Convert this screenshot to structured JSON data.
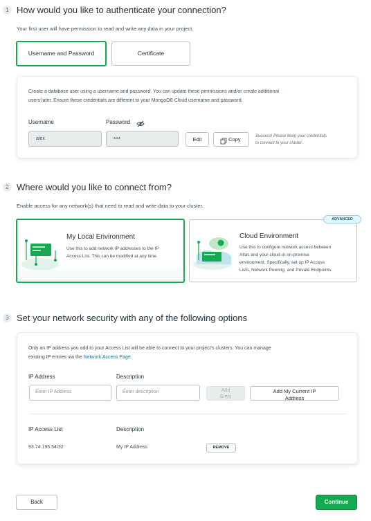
{
  "step1": {
    "number": "1",
    "title": "How would you like to authenticate your connection?",
    "description": "Your first user will have permission to read and write any data in your project.",
    "tabs": [
      {
        "label": "Username and Password"
      },
      {
        "label": "Certificate"
      }
    ],
    "panel": {
      "description_line1": "Create a database user using a username and password. You can update these permissions and/or create additional",
      "description_line2": "users later. Ensure these credentials are different to your MongoDB Cloud username and password.",
      "username_label": "Username",
      "password_label": "Password",
      "username_value": "alex",
      "password_value": "••••",
      "edit_label": "Edit",
      "copy_label": "Copy",
      "success_line1": "Success! Please keep your credentials",
      "success_line2": "to connect to your cluster."
    }
  },
  "step2": {
    "number": "2",
    "title": "Where would you like to connect from?",
    "description": "Enable access for any network(s) that need to read and write data to your cluster.",
    "badge": "ADVANCED",
    "local": {
      "title": "My Local Environment",
      "desc_line1": "Use this to add network IP addresses to the IP",
      "desc_line2": "Access List. This can be modified at any time."
    },
    "cloud": {
      "title": "Cloud Environment",
      "desc_line1": "Use this to configure network access between",
      "desc_line2": "Atlas and your cloud or on-premise",
      "desc_line3": "environment. Specifically, set up IP Access",
      "desc_line4": "Lists, Network Peering, and Private Endpoints."
    }
  },
  "step3": {
    "number": "3",
    "title": "Set your network security with any of the following options",
    "panel": {
      "desc_line1": "Only an IP address you add to your Access List will be able to connect to your project's clusters. You can manage",
      "desc_line2_prefix": "existing IP entries via the",
      "desc_link": "Network Access Page",
      "desc_suffix": ".",
      "ip_label": "IP Address",
      "description_label": "Description",
      "ip_placeholder": "Enter IP Address",
      "description_placeholder": "Enter description",
      "add_entry_line1": "Add",
      "add_entry_line2": "Entry",
      "add_my_ip_line1": "Add My Current IP",
      "add_my_ip_line2": "Address",
      "list_header": "IP Access List",
      "list_desc_header": "Description",
      "rows": [
        {
          "ip": "93.74.195.54/32",
          "description": "My IP Address",
          "action": "REMOVE"
        }
      ]
    }
  },
  "footer": {
    "back_label": "Back",
    "continue_label": "Continue"
  },
  "colors": {
    "accent_green": "#13aa52",
    "primary_button": "#13aa52",
    "link": "#007cad"
  }
}
